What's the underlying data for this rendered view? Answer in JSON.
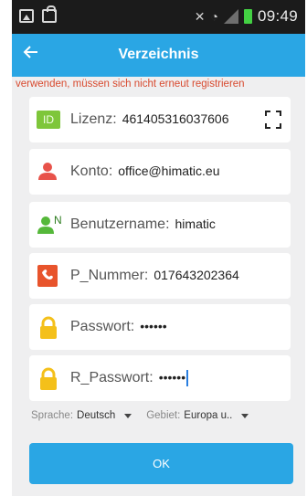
{
  "status_bar": {
    "time": "09:49"
  },
  "app_bar": {
    "title": "Verzeichnis"
  },
  "notice": "verwenden, müssen sich nicht erneut registrieren",
  "fields": {
    "license": {
      "label": "Lizenz:",
      "value": "461405316037606",
      "icon": "id-badge-icon",
      "icon_text": "ID"
    },
    "account": {
      "label": "Konto:",
      "value": "office@himatic.eu",
      "icon": "person-icon"
    },
    "username": {
      "label": "Benutzername:",
      "value": "himatic",
      "icon": "user-n-icon",
      "icon_text": "N"
    },
    "phone": {
      "label": "P_Nummer:",
      "value": "017643202364",
      "icon": "phone-icon"
    },
    "password": {
      "label": "Passwort:",
      "value": "••••••",
      "icon": "lock-icon"
    },
    "password_repeat": {
      "label": "R_Passwort:",
      "value": "••••••",
      "icon": "lock-icon"
    }
  },
  "selectors": {
    "language": {
      "label": "Sprache:",
      "value": "Deutsch"
    },
    "region": {
      "label": "Gebiet:",
      "value": "Europa u.."
    }
  },
  "ok_label": "OK",
  "colors": {
    "primary": "#2aa6e4",
    "notice": "#d84a2f",
    "id_badge": "#7ec63a",
    "person": "#e8524a",
    "user_n": "#55b83a",
    "phone": "#e8542c",
    "lock": "#f4c01a",
    "background": "#efeff0"
  }
}
